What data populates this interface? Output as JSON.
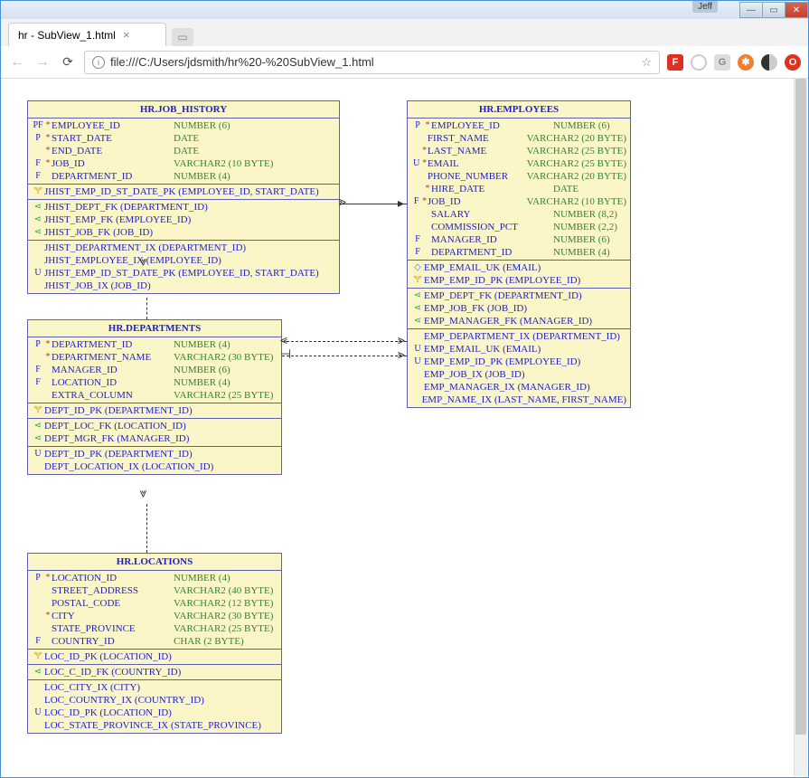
{
  "window": {
    "user": "Jeff",
    "tab_title": "hr - SubView_1.html",
    "url": "file:///C:/Users/jdsmith/hr%20-%20SubView_1.html"
  },
  "entities": {
    "job_history": {
      "title": "HR.JOB_HISTORY",
      "cols": [
        {
          "flag": "PF",
          "dot": "*",
          "name": "EMPLOYEE_ID",
          "type": "NUMBER (6)"
        },
        {
          "flag": "P",
          "dot": "*",
          "name": "START_DATE",
          "type": "DATE"
        },
        {
          "flag": "",
          "dot": "*",
          "name": "END_DATE",
          "type": "DATE"
        },
        {
          "flag": "F",
          "dot": "*",
          "name": "JOB_ID",
          "type": "VARCHAR2 (10 BYTE)"
        },
        {
          "flag": "F",
          "dot": "",
          "name": "DEPARTMENT_ID",
          "type": "NUMBER (4)"
        }
      ],
      "pk": [
        {
          "icon": "key",
          "text": "JHIST_EMP_ID_ST_DATE_PK (EMPLOYEE_ID, START_DATE)"
        }
      ],
      "fk": [
        {
          "icon": "fk",
          "text": "JHIST_DEPT_FK (DEPARTMENT_ID)"
        },
        {
          "icon": "fk",
          "text": "JHIST_EMP_FK (EMPLOYEE_ID)"
        },
        {
          "icon": "fk",
          "text": "JHIST_JOB_FK (JOB_ID)"
        }
      ],
      "ix": [
        {
          "flag": "",
          "text": "JHIST_DEPARTMENT_IX (DEPARTMENT_ID)"
        },
        {
          "flag": "",
          "text": "JHIST_EMPLOYEE_IX (EMPLOYEE_ID)"
        },
        {
          "flag": "U",
          "text": "JHIST_EMP_ID_ST_DATE_PK (EMPLOYEE_ID, START_DATE)"
        },
        {
          "flag": "",
          "text": "JHIST_JOB_IX (JOB_ID)"
        }
      ]
    },
    "employees": {
      "title": "HR.EMPLOYEES",
      "cols": [
        {
          "flag": "P",
          "dot": "*",
          "name": "EMPLOYEE_ID",
          "type": "NUMBER (6)"
        },
        {
          "flag": "",
          "dot": "",
          "name": "FIRST_NAME",
          "type": "VARCHAR2 (20 BYTE)"
        },
        {
          "flag": "",
          "dot": "*",
          "name": "LAST_NAME",
          "type": "VARCHAR2 (25 BYTE)"
        },
        {
          "flag": "U",
          "dot": "*",
          "name": "EMAIL",
          "type": "VARCHAR2 (25 BYTE)"
        },
        {
          "flag": "",
          "dot": "",
          "name": "PHONE_NUMBER",
          "type": "VARCHAR2 (20 BYTE)"
        },
        {
          "flag": "",
          "dot": "*",
          "name": "HIRE_DATE",
          "type": "DATE"
        },
        {
          "flag": "F",
          "dot": "*",
          "name": "JOB_ID",
          "type": "VARCHAR2 (10 BYTE)"
        },
        {
          "flag": "",
          "dot": "",
          "name": "SALARY",
          "type": "NUMBER (8,2)"
        },
        {
          "flag": "",
          "dot": "",
          "name": "COMMISSION_PCT",
          "type": "NUMBER (2,2)"
        },
        {
          "flag": "F",
          "dot": "",
          "name": "MANAGER_ID",
          "type": "NUMBER (6)"
        },
        {
          "flag": "F",
          "dot": "",
          "name": "DEPARTMENT_ID",
          "type": "NUMBER (4)"
        }
      ],
      "uk": [
        {
          "icon": "diam",
          "text": "EMP_EMAIL_UK (EMAIL)"
        },
        {
          "icon": "key",
          "text": "EMP_EMP_ID_PK (EMPLOYEE_ID)"
        }
      ],
      "fk": [
        {
          "icon": "fk",
          "text": "EMP_DEPT_FK (DEPARTMENT_ID)"
        },
        {
          "icon": "fk",
          "text": "EMP_JOB_FK (JOB_ID)"
        },
        {
          "icon": "fk",
          "text": "EMP_MANAGER_FK (MANAGER_ID)"
        }
      ],
      "ix": [
        {
          "flag": "",
          "text": "EMP_DEPARTMENT_IX (DEPARTMENT_ID)"
        },
        {
          "flag": "U",
          "text": "EMP_EMAIL_UK (EMAIL)"
        },
        {
          "flag": "U",
          "text": "EMP_EMP_ID_PK (EMPLOYEE_ID)"
        },
        {
          "flag": "",
          "text": "EMP_JOB_IX (JOB_ID)"
        },
        {
          "flag": "",
          "text": "EMP_MANAGER_IX (MANAGER_ID)"
        },
        {
          "flag": "",
          "text": "EMP_NAME_IX (LAST_NAME, FIRST_NAME)"
        }
      ]
    },
    "departments": {
      "title": "HR.DEPARTMENTS",
      "cols": [
        {
          "flag": "P",
          "dot": "*",
          "name": "DEPARTMENT_ID",
          "type": "NUMBER (4)"
        },
        {
          "flag": "",
          "dot": "*",
          "name": "DEPARTMENT_NAME",
          "type": "VARCHAR2 (30 BYTE)"
        },
        {
          "flag": "F",
          "dot": "",
          "name": "MANAGER_ID",
          "type": "NUMBER (6)"
        },
        {
          "flag": "F",
          "dot": "",
          "name": "LOCATION_ID",
          "type": "NUMBER (4)"
        },
        {
          "flag": "",
          "dot": "",
          "name": "EXTRA_COLUMN",
          "type": "VARCHAR2 (25 BYTE)"
        }
      ],
      "pk": [
        {
          "icon": "key",
          "text": "DEPT_ID_PK (DEPARTMENT_ID)"
        }
      ],
      "fk": [
        {
          "icon": "fk",
          "text": "DEPT_LOC_FK (LOCATION_ID)"
        },
        {
          "icon": "fk",
          "text": "DEPT_MGR_FK (MANAGER_ID)"
        }
      ],
      "ix": [
        {
          "flag": "U",
          "text": "DEPT_ID_PK (DEPARTMENT_ID)"
        },
        {
          "flag": "",
          "text": "DEPT_LOCATION_IX (LOCATION_ID)"
        }
      ]
    },
    "locations": {
      "title": "HR.LOCATIONS",
      "cols": [
        {
          "flag": "P",
          "dot": "*",
          "name": "LOCATION_ID",
          "type": "NUMBER (4)"
        },
        {
          "flag": "",
          "dot": "",
          "name": "STREET_ADDRESS",
          "type": "VARCHAR2 (40 BYTE)"
        },
        {
          "flag": "",
          "dot": "",
          "name": "POSTAL_CODE",
          "type": "VARCHAR2 (12 BYTE)"
        },
        {
          "flag": "",
          "dot": "*",
          "name": "CITY",
          "type": "VARCHAR2 (30 BYTE)"
        },
        {
          "flag": "",
          "dot": "",
          "name": "STATE_PROVINCE",
          "type": "VARCHAR2 (25 BYTE)"
        },
        {
          "flag": "F",
          "dot": "",
          "name": "COUNTRY_ID",
          "type": "CHAR (2 BYTE)"
        }
      ],
      "pk": [
        {
          "icon": "key",
          "text": "LOC_ID_PK (LOCATION_ID)"
        }
      ],
      "fk": [
        {
          "icon": "fk",
          "text": "LOC_C_ID_FK (COUNTRY_ID)"
        }
      ],
      "ix": [
        {
          "flag": "",
          "text": "LOC_CITY_IX (CITY)"
        },
        {
          "flag": "",
          "text": "LOC_COUNTRY_IX (COUNTRY_ID)"
        },
        {
          "flag": "U",
          "text": "LOC_ID_PK (LOCATION_ID)"
        },
        {
          "flag": "",
          "text": "LOC_STATE_PROVINCE_IX (STATE_PROVINCE)"
        }
      ]
    }
  }
}
